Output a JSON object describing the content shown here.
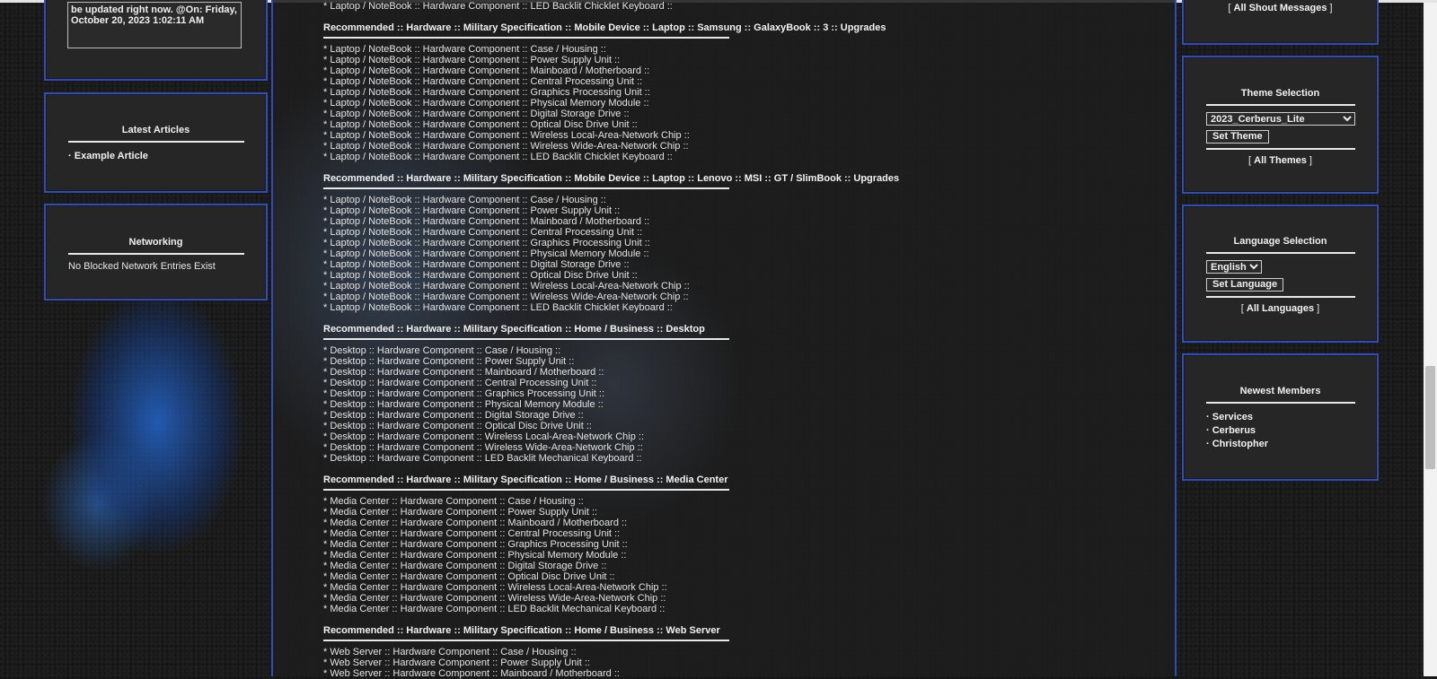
{
  "shoutbox": {
    "message_text": "be updated right now. @On: Friday, October 20, 2023 1:02:11 AM"
  },
  "latest_articles": {
    "title": "Latest Articles",
    "items": [
      "Example Article"
    ]
  },
  "networking": {
    "title": "Networking",
    "text": "No Blocked Network Entries Exist"
  },
  "main": {
    "top_line": "* Laptop / NoteBook :: Hardware Component :: LED Backlit Chicklet Keyboard ::",
    "sections": [
      {
        "heading": "Recommended :: Hardware :: Military Specification :: Mobile Device :: Laptop :: Samsung :: GalaxyBook :: 3 :: Upgrades",
        "lines": [
          "* Laptop / NoteBook :: Hardware Component :: Case / Housing ::",
          "* Laptop / NoteBook :: Hardware Component :: Power Supply Unit ::",
          "* Laptop / NoteBook :: Hardware Component :: Mainboard / Motherboard ::",
          "* Laptop / NoteBook :: Hardware Component :: Central Processing Unit ::",
          "* Laptop / NoteBook :: Hardware Component :: Graphics Processing Unit ::",
          "* Laptop / NoteBook :: Hardware Component :: Physical Memory Module ::",
          "* Laptop / NoteBook :: Hardware Component :: Digital Storage Drive ::",
          "* Laptop / NoteBook :: Hardware Component :: Optical Disc Drive Unit ::",
          "* Laptop / NoteBook :: Hardware Component :: Wireless Local-Area-Network Chip ::",
          "* Laptop / NoteBook :: Hardware Component :: Wireless Wide-Area-Network Chip ::",
          "* Laptop / NoteBook :: Hardware Component :: LED Backlit Chicklet Keyboard ::"
        ]
      },
      {
        "heading": "Recommended :: Hardware :: Military Specification :: Mobile Device :: Laptop :: Lenovo :: MSI :: GT / SlimBook :: Upgrades",
        "lines": [
          "* Laptop / NoteBook :: Hardware Component :: Case / Housing ::",
          "* Laptop / NoteBook :: Hardware Component :: Power Supply Unit ::",
          "* Laptop / NoteBook :: Hardware Component :: Mainboard / Motherboard ::",
          "* Laptop / NoteBook :: Hardware Component :: Central Processing Unit ::",
          "* Laptop / NoteBook :: Hardware Component :: Graphics Processing Unit ::",
          "* Laptop / NoteBook :: Hardware Component :: Physical Memory Module ::",
          "* Laptop / NoteBook :: Hardware Component :: Digital Storage Drive ::",
          "* Laptop / NoteBook :: Hardware Component :: Optical Disc Drive Unit ::",
          "* Laptop / NoteBook :: Hardware Component :: Wireless Local-Area-Network Chip ::",
          "* Laptop / NoteBook :: Hardware Component :: Wireless Wide-Area-Network Chip ::",
          "* Laptop / NoteBook :: Hardware Component :: LED Backlit Chicklet Keyboard ::"
        ]
      },
      {
        "heading": "Recommended :: Hardware :: Military Specification :: Home / Business :: Desktop",
        "lines": [
          "* Desktop :: Hardware Component :: Case / Housing ::",
          "* Desktop :: Hardware Component :: Power Supply Unit ::",
          "* Desktop :: Hardware Component :: Mainboard / Motherboard ::",
          "* Desktop :: Hardware Component :: Central Processing Unit ::",
          "* Desktop :: Hardware Component :: Graphics Processing Unit ::",
          "* Desktop :: Hardware Component :: Physical Memory Module ::",
          "* Desktop :: Hardware Component :: Digital Storage Drive ::",
          "* Desktop :: Hardware Component :: Optical Disc Drive Unit ::",
          "* Desktop :: Hardware Component :: Wireless Local-Area-Network Chip ::",
          "* Desktop :: Hardware Component :: Wireless Wide-Area-Network Chip ::",
          "* Desktop :: Hardware Component :: LED Backlit Mechanical Keyboard ::"
        ]
      },
      {
        "heading": "Recommended :: Hardware :: Military Specification :: Home / Business :: Media Center",
        "lines": [
          "* Media Center :: Hardware Component :: Case / Housing ::",
          "* Media Center :: Hardware Component :: Power Supply Unit ::",
          "* Media Center :: Hardware Component :: Mainboard / Motherboard ::",
          "* Media Center :: Hardware Component :: Central Processing Unit ::",
          "* Media Center :: Hardware Component :: Graphics Processing Unit ::",
          "* Media Center :: Hardware Component :: Physical Memory Module ::",
          "* Media Center :: Hardware Component :: Digital Storage Drive ::",
          "* Media Center :: Hardware Component :: Optical Disc Drive Unit ::",
          "* Media Center :: Hardware Component :: Wireless Local-Area-Network Chip ::",
          "* Media Center :: Hardware Component :: Wireless Wide-Area-Network Chip ::",
          "* Media Center :: Hardware Component :: LED Backlit Mechanical Keyboard ::"
        ]
      },
      {
        "heading": "Recommended :: Hardware :: Military Specification :: Home / Business :: Web Server",
        "lines": [
          "* Web Server :: Hardware Component :: Case / Housing ::",
          "* Web Server :: Hardware Component :: Power Supply Unit ::",
          "* Web Server :: Hardware Component :: Mainboard / Motherboard ::"
        ]
      }
    ]
  },
  "shout_messages": {
    "link": "All Shout Messages"
  },
  "theme_selection": {
    "title": "Theme Selection",
    "selected": "2023_Cerberus_Lite",
    "button": "Set Theme",
    "link": "All Themes"
  },
  "language_selection": {
    "title": "Language Selection",
    "selected": "English",
    "button": "Set Language",
    "link": "All Languages"
  },
  "newest_members": {
    "title": "Newest Members",
    "items": [
      "Services",
      "Cerberus",
      "Christopher"
    ]
  }
}
